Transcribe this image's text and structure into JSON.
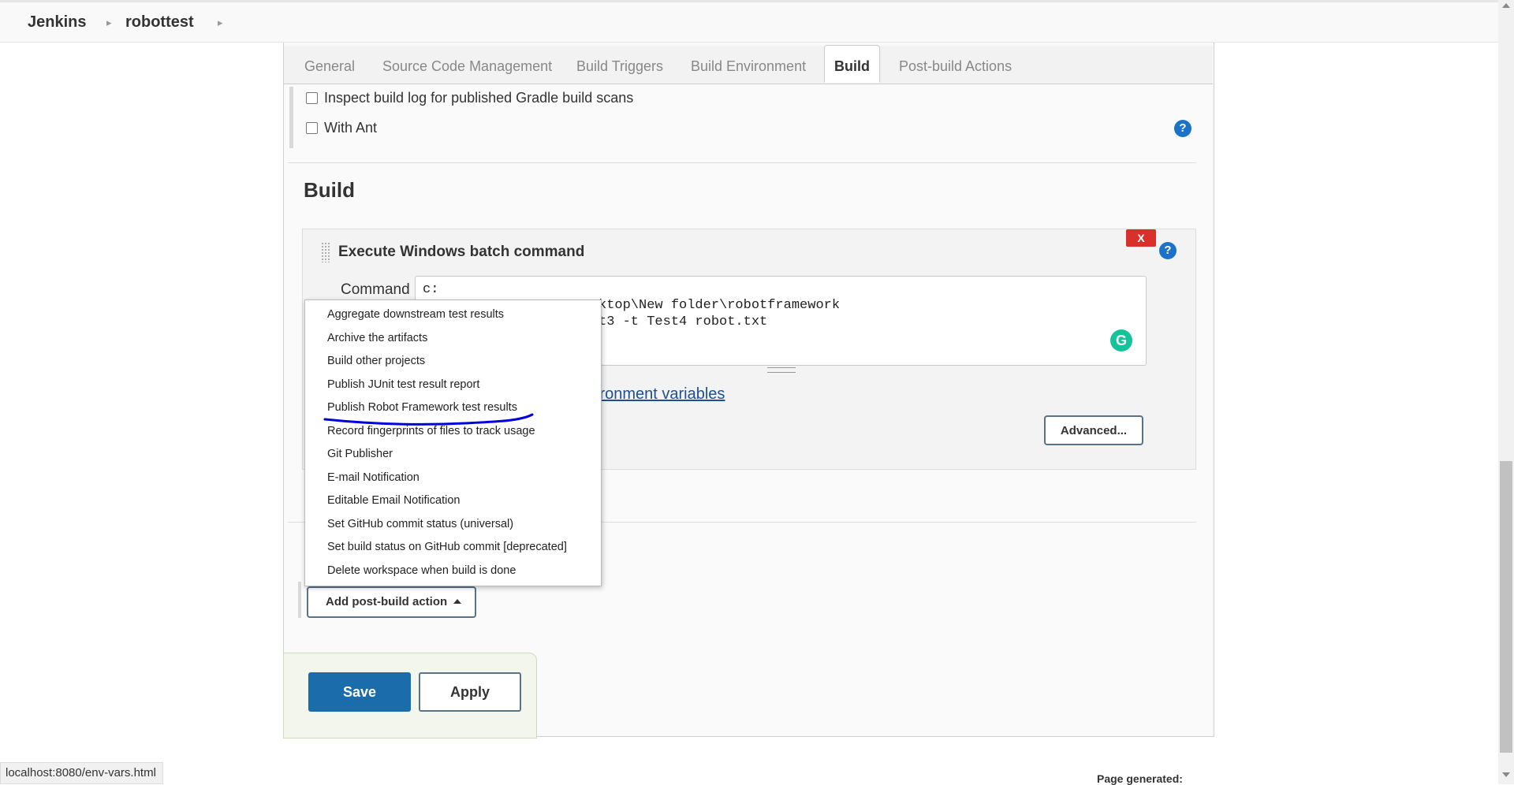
{
  "breadcrumb": {
    "items": [
      "Jenkins",
      "robottest"
    ]
  },
  "tabs": [
    "General",
    "Source Code Management",
    "Build Triggers",
    "Build Environment",
    "Build",
    "Post-build Actions"
  ],
  "build_env": {
    "options": [
      "Inspect build log for published Gradle build scans",
      "With Ant"
    ]
  },
  "build_section": {
    "title": "Build",
    "step_title": "Execute Windows batch command",
    "delete_label": "X",
    "command_label": "Command",
    "command_line1": "c:",
    "command_line2_visible": "ktop\\New folder\\robotframework",
    "command_line3_visible": "t3 -t Test4 robot.txt",
    "env_link_visible": "ironment variables",
    "advanced_label": "Advanced..."
  },
  "post_build_menu": {
    "items": [
      "Aggregate downstream test results",
      "Archive the artifacts",
      "Build other projects",
      "Publish JUnit test result report",
      "Publish Robot Framework test results",
      "Record fingerprints of files to track usage",
      "Git Publisher",
      "E-mail Notification",
      "Editable Email Notification",
      "Set GitHub commit status (universal)",
      "Set build status on GitHub commit [deprecated]",
      "Delete workspace when build is done"
    ],
    "highlighted_item": "Publish Robot Framework test results",
    "highlight_color": "#0000dd"
  },
  "add_post_build_label": "Add post-build action",
  "save_label": "Save",
  "apply_label": "Apply",
  "status_bar_url": "localhost:8080/env-vars.html",
  "footer_text": "Page generated:",
  "colors": {
    "primary": "#1b6cab",
    "danger": "#d9302c",
    "help": "#1a73c8",
    "link": "#1d4f91"
  }
}
